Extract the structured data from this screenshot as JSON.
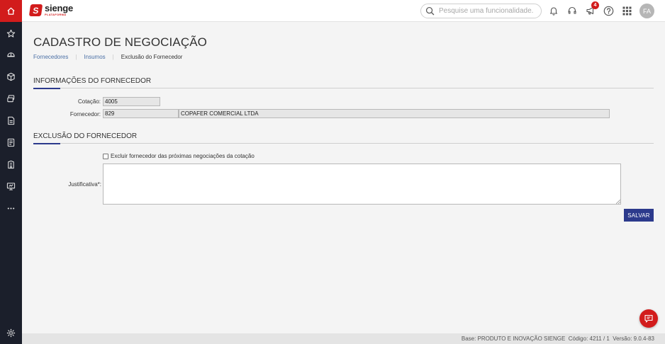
{
  "sidebar": {
    "items": [
      {
        "icon": "home-icon"
      },
      {
        "icon": "star-icon"
      },
      {
        "icon": "helmet-icon"
      },
      {
        "icon": "box-icon"
      },
      {
        "icon": "stack-icon"
      },
      {
        "icon": "document-icon"
      },
      {
        "icon": "report-icon"
      },
      {
        "icon": "building-icon"
      },
      {
        "icon": "monitor-icon"
      },
      {
        "icon": "more-icon"
      },
      {
        "icon": "gear-icon"
      }
    ],
    "accent_color": "#d21c1c",
    "bg_color": "#1b1f2b"
  },
  "header": {
    "logo_name": "sienge",
    "logo_sub": "PLATAFORMA",
    "search_placeholder": "Pesquise uma funcionalidade.",
    "notification_count": "4",
    "avatar_initials": "FA"
  },
  "page": {
    "title": "CADASTRO DE NEGOCIAÇÃO",
    "breadcrumb": [
      "Fornecedores",
      "Insumos",
      "Exclusão do Fornecedor"
    ]
  },
  "supplier_info": {
    "section_title": "INFORMAÇÕES DO FORNECEDOR",
    "cotacao_label": "Cotação:",
    "cotacao_value": "4005",
    "fornecedor_label": "Fornecedor:",
    "fornecedor_code": "829",
    "fornecedor_name": "COPAFER COMERCIAL LTDA"
  },
  "exclusion": {
    "section_title": "EXCLUSÃO DO FORNECEDOR",
    "checkbox_label": "Excluir fornecedor das próximas negociações da cotação",
    "checkbox_checked": false,
    "justificativa_label": "Justificativa*:",
    "justificativa_value": "",
    "save_label": "SALVAR"
  },
  "footer": {
    "text": "Base: PRODUTO E INOVAÇÃO SIENGE  Código: 4211 / 1  Versão: 9.0.4-83"
  },
  "colors": {
    "primary": "#2c3a8c",
    "brand_red": "#d21c1c"
  }
}
